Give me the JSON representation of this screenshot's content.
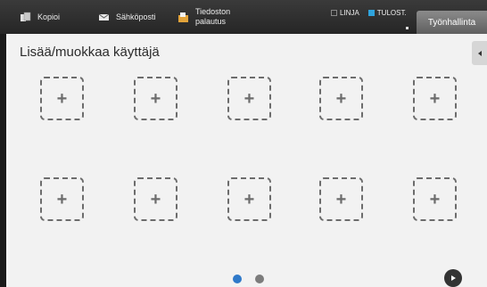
{
  "topbar": {
    "modes": [
      {
        "label": "Kopioi",
        "icon": "copy-icon"
      },
      {
        "label": "Sähköposti",
        "icon": "email-icon"
      },
      {
        "label_line1": "Tiedoston",
        "label_line2": "palautus",
        "icon": "file-retrieve-icon"
      }
    ],
    "indicators": {
      "line": "LINJA",
      "print": "TULOST."
    },
    "job_status_label": "Työnhallinta"
  },
  "main": {
    "title": "Lisää/muokkaa käyttäjä",
    "slot_plus": "+",
    "slots": 10
  },
  "pagination": {
    "pages": 2,
    "current": 1
  },
  "colors": {
    "accent_blue": "#2f79c9",
    "print_indicator": "#2fa3dc"
  }
}
